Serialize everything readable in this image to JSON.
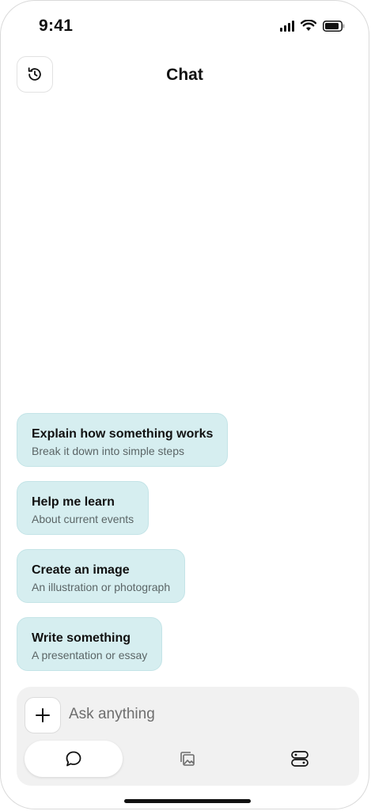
{
  "status_bar": {
    "time": "9:41",
    "icons": [
      "signal-icon",
      "wifi-icon",
      "battery-icon"
    ]
  },
  "header": {
    "title": "Chat",
    "history_icon": "history-icon"
  },
  "suggestions": [
    {
      "title": "Explain how something works",
      "subtitle": "Break it down into simple steps"
    },
    {
      "title": "Help me learn",
      "subtitle": "About current events"
    },
    {
      "title": "Create an image",
      "subtitle": "An illustration or photograph"
    },
    {
      "title": "Write something",
      "subtitle": "A presentation or essay"
    }
  ],
  "composer": {
    "placeholder": "Ask anything",
    "value": "",
    "plus_icon": "plus-icon",
    "modes": [
      {
        "icon": "chat-bubble-icon",
        "selected": true
      },
      {
        "icon": "image-gallery-icon",
        "selected": false
      },
      {
        "icon": "apps-icon",
        "selected": false
      }
    ]
  },
  "colors": {
    "suggestion_bg": "#d6eef0",
    "composer_bg": "#f1f1f1",
    "text_primary": "#111111",
    "text_secondary": "#5b6566"
  }
}
